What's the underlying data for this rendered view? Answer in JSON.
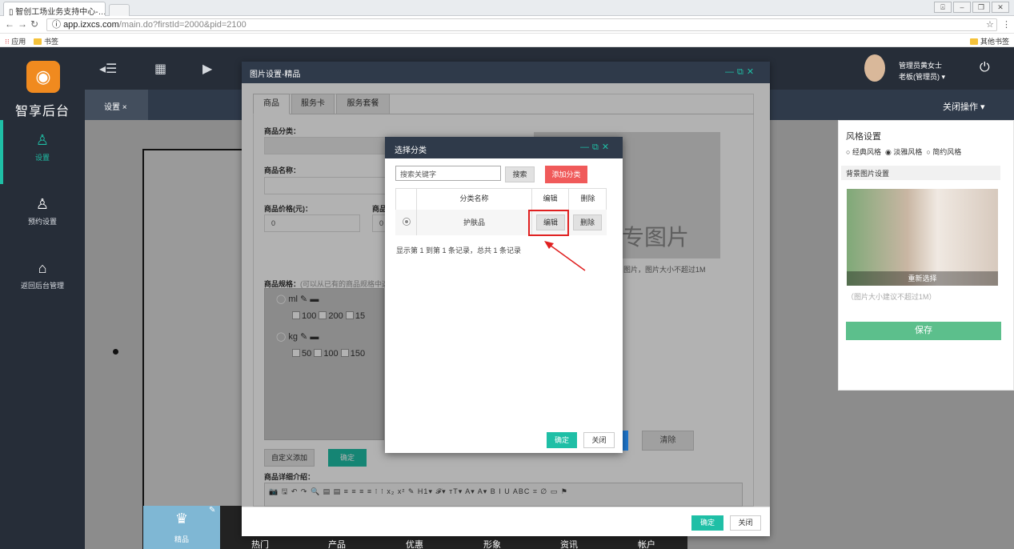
{
  "browser": {
    "tab_title": "智创工场业务支持中心-…",
    "tab_close": "×",
    "url_domain": "app.izxcs.com",
    "url_path": "/main.do?firstId=2000&pid=2100",
    "bookmarks": {
      "apps": "应用",
      "bookmarks": "书签",
      "other": "其他书签"
    }
  },
  "app": {
    "logo_text": "智享后台",
    "nav": [
      {
        "label": "设置"
      },
      {
        "label": "预约设置"
      },
      {
        "label": "返回后台管理"
      }
    ],
    "admin_name": "管理员黄女士",
    "admin_role": "老板(管理员) ▾",
    "tab_label": "设置 ×",
    "close_ops": "关闭操作 ▾"
  },
  "bottom_nav": {
    "items": [
      "精品",
      "热门",
      "产品",
      "优惠",
      "形象",
      "资讯",
      "帐户"
    ]
  },
  "right_panel": {
    "style_title": "风格设置",
    "styles": [
      "经典风格",
      "淡雅风格",
      "简约风格"
    ],
    "bg_title": "背景图片设置",
    "reselect": "重新选择",
    "hint": "（图片大小建议不超过1M）",
    "save": "保存"
  },
  "modal1": {
    "title": "图片设置-精品",
    "tabs": [
      "商品",
      "服务卡",
      "服务套餐"
    ],
    "category_label": "商品分类：",
    "name_label": "商品名称：",
    "price_label": "商品价格(元)：",
    "price2_label": "商品",
    "price_value": "0",
    "price2_value": "0",
    "spec_label": "商品规格：",
    "spec_hint": "(可以从已有的商品规格中选",
    "spec_units": [
      {
        "unit": "ml",
        "values": [
          "100",
          "200",
          "15"
        ]
      },
      {
        "unit": "kg",
        "values": [
          "50",
          "100",
          "150"
        ]
      }
    ],
    "image_text": "专图片",
    "image_hint": "图片，图片大小不超过1M",
    "custom_add": "自定义添加",
    "confirm_small": "确定",
    "clear": "清除",
    "detail_label": "商品详细介绍：",
    "editor_toolbar": "📷 🖫 ↶ ↷ 🔍 ▤ ▤ ≡ ≡ ≡ ≡ ⁝ ⁝ x₂ x² ✎ H1▾ 𝓕▾ тT▾ A▾ A▾ B I U ABC ⌗ ∅ ▭ ⚑",
    "ok": "确定",
    "close": "关闭"
  },
  "modal2": {
    "title": "选择分类",
    "search_placeholder": "搜索关键字",
    "search_btn": "搜索",
    "add_btn": "添加分类",
    "columns": [
      "分类名称",
      "编辑",
      "删除"
    ],
    "rows": [
      {
        "name": "护肤品",
        "edit": "编辑",
        "delete": "删除"
      }
    ],
    "record_info": "显示第 1 到第 1 条记录，总共 1 条记录",
    "ok": "确定",
    "close": "关闭"
  },
  "colors": {
    "accent": "#1fbfa6",
    "header": "#2f3a4a",
    "danger": "#f05a5a",
    "highlight": "#e02020"
  }
}
